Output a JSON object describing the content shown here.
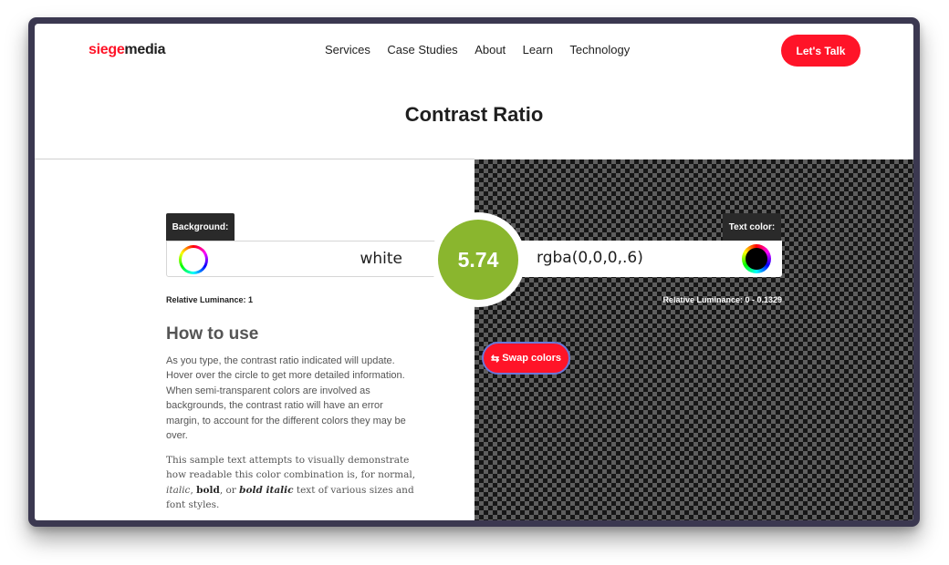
{
  "header": {
    "logo": {
      "part1": "siege",
      "part2": "media"
    },
    "nav": [
      {
        "label": "Services"
      },
      {
        "label": "Case Studies"
      },
      {
        "label": "About"
      },
      {
        "label": "Learn"
      },
      {
        "label": "Technology"
      }
    ],
    "cta_label": "Let's Talk"
  },
  "page_title": "Contrast Ratio",
  "background_field": {
    "tab_label": "Background:",
    "value": "white",
    "luminance_label": "Relative Luminance: 1",
    "swatch_color": "#ffffff"
  },
  "ratio": {
    "value": "5.74",
    "color": "#8ab62e"
  },
  "text_field": {
    "tab_label": "Text color:",
    "value": "rgba(0,0,0,.6)",
    "luminance_label": "Relative Luminance: 0 - 0.1329",
    "swatch_color": "#000000"
  },
  "swap_button": {
    "icon": "swap-arrows-icon",
    "glyph": "⇆",
    "label": "Swap colors"
  },
  "how_to_use": {
    "title": "How to use",
    "body": "As you type, the contrast ratio indicated will update. Hover over the circle to get more detailed information. When semi-transparent colors are involved as backgrounds, the contrast ratio will have an error margin, to account for the different colors they may be over."
  },
  "sample_text": {
    "part1": "This sample text attempts to visually demonstrate how readable this color combination is, for normal, ",
    "italic": "italic",
    "part2": ", ",
    "bold": "bold",
    "part3": ", or ",
    "bold_italic": "bold italic",
    "part4": " text of various sizes and font styles."
  },
  "colors": {
    "brand_red": "#ff1428",
    "ratio_green": "#8ab62e",
    "frame": "#3b3850"
  }
}
